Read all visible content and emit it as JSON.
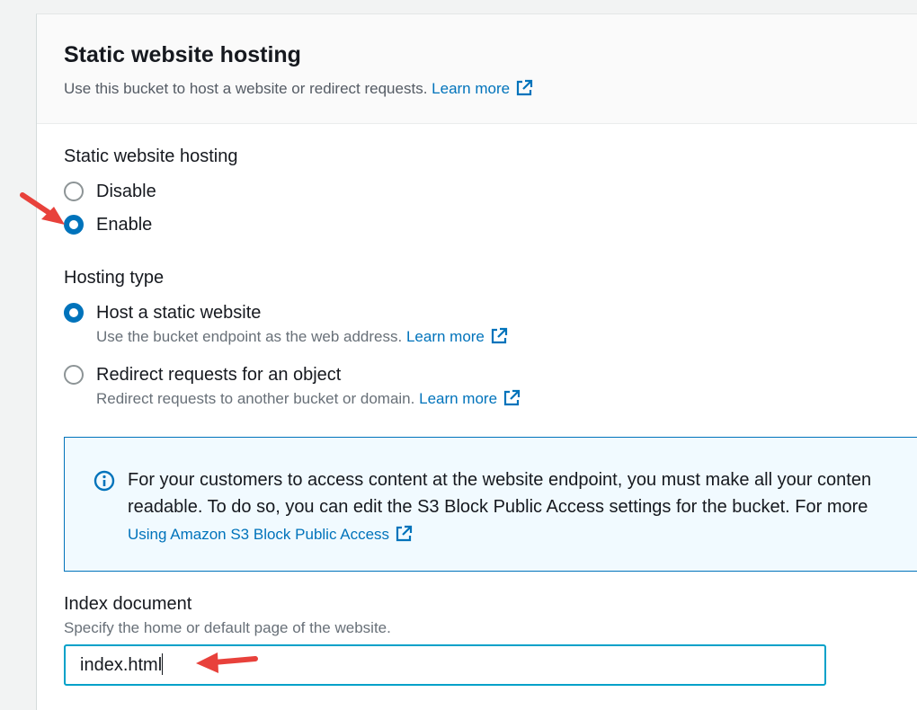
{
  "header": {
    "title": "Static website hosting",
    "description": "Use this bucket to host a website or redirect requests.",
    "learn_more": "Learn more"
  },
  "hosting": {
    "label": "Static website hosting",
    "options": [
      {
        "label": "Disable",
        "checked": false
      },
      {
        "label": "Enable",
        "checked": true
      }
    ]
  },
  "hosting_type": {
    "label": "Hosting type",
    "options": [
      {
        "label": "Host a static website",
        "description": "Use the bucket endpoint as the web address.",
        "learn_more": "Learn more",
        "checked": true
      },
      {
        "label": "Redirect requests for an object",
        "description": "Redirect requests to another bucket or domain.",
        "learn_more": "Learn more",
        "checked": false
      }
    ]
  },
  "info_alert": {
    "line1": "For your customers to access content at the website endpoint, you must make all your conten",
    "line2": "readable. To do so, you can edit the S3 Block Public Access settings for the bucket. For more",
    "link": "Using Amazon S3 Block Public Access"
  },
  "index_document": {
    "label": "Index document",
    "description": "Specify the home or default page of the website.",
    "value": "index.html"
  },
  "colors": {
    "link": "#0073bb",
    "annotation_arrow": "#e8413b",
    "input_focus": "#00a1c9"
  }
}
